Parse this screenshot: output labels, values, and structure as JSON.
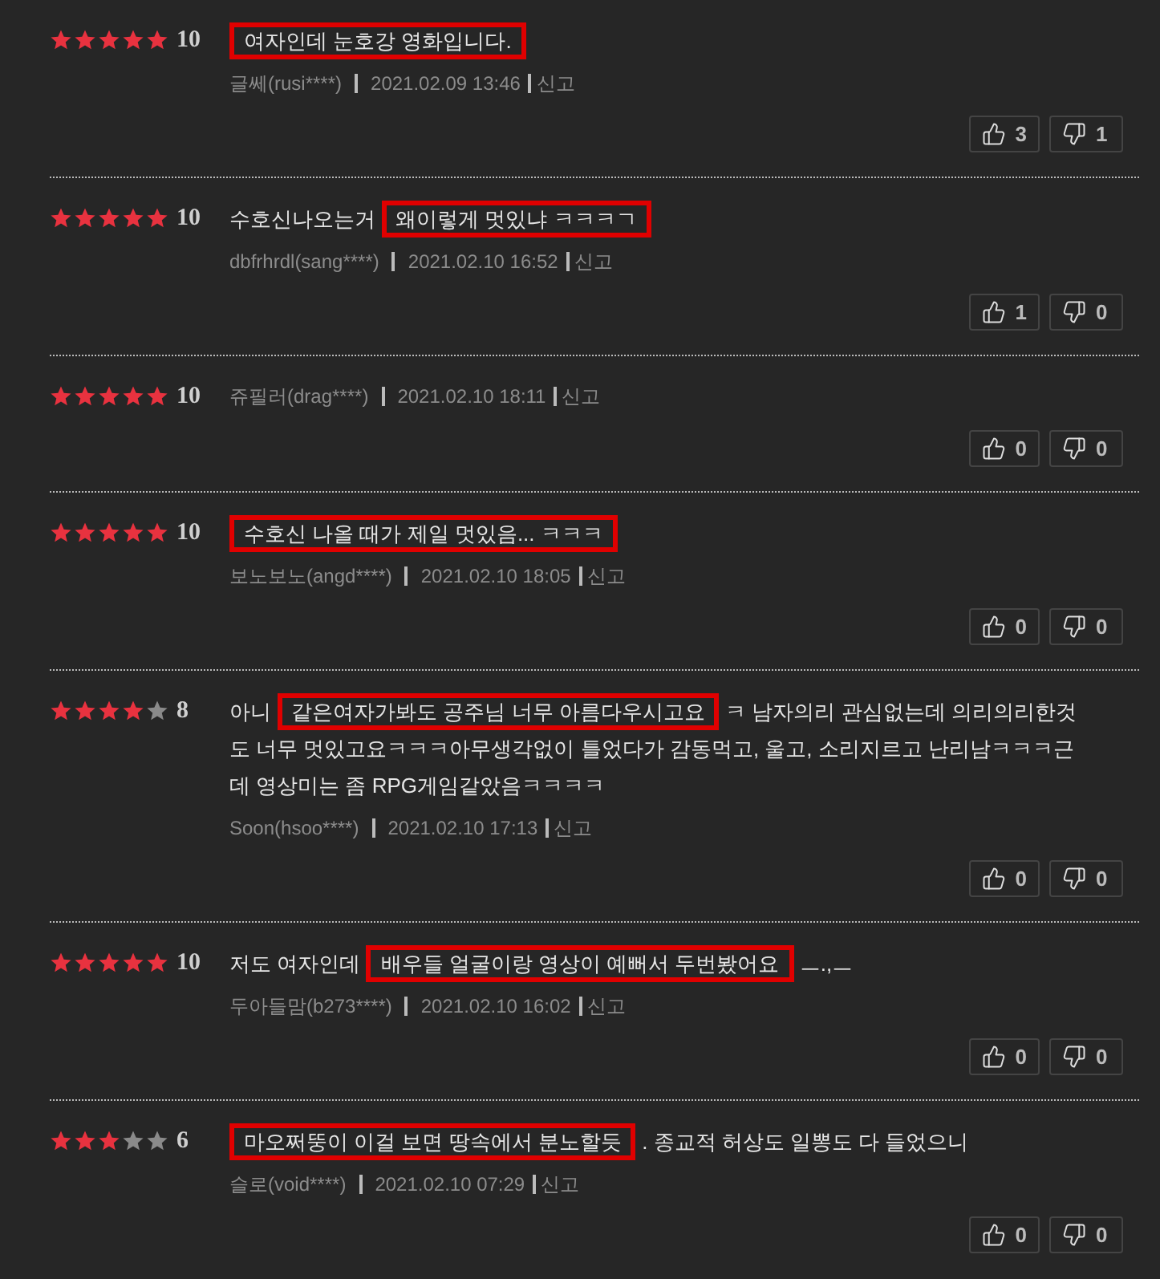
{
  "reviews": [
    {
      "stars": 5,
      "score": "10",
      "highlight": "여자인데 눈호강 영화입니다.",
      "user": "글쎄(rusi****)",
      "date": "2021.02.09 13:46",
      "report": "신고",
      "likes": "3",
      "dislikes": "1"
    },
    {
      "stars": 5,
      "score": "10",
      "text_before": "수호신나오는거",
      "highlight": "왜이렇게 멋있냐 ㅋㅋㅋㄱ",
      "user": "dbfrhrdl(sang****)",
      "date": "2021.02.10 16:52",
      "report": "신고",
      "likes": "1",
      "dislikes": "0"
    },
    {
      "stars": 5,
      "score": "10",
      "user": "쥬필러(drag****)",
      "date": "2021.02.10 18:11",
      "report": "신고",
      "likes": "0",
      "dislikes": "0"
    },
    {
      "stars": 5,
      "score": "10",
      "highlight": "수호신 나올 때가 제일 멋있음... ㅋㅋㅋ",
      "user": "보노보노(angd****)",
      "date": "2021.02.10 18:05",
      "report": "신고",
      "likes": "0",
      "dislikes": "0"
    },
    {
      "stars": 4,
      "score": "8",
      "text_before": "아니",
      "highlight": "같은여자가봐도 공주님 너무 아름다우시고요",
      "text_after": "ㅋ 남자의리 관심없는데 의리의리한것도 너무 멋있고요ㅋㅋㅋ아무생각없이 틀었다가 감동먹고, 울고, 소리지르고 난리남ㅋㅋㅋ근데 영상미는 좀 RPG게임같았음ㅋㅋㅋㅋ",
      "user": "Soon(hsoo****)",
      "date": "2021.02.10 17:13",
      "report": "신고",
      "likes": "0",
      "dislikes": "0"
    },
    {
      "stars": 5,
      "score": "10",
      "text_before": "저도 여자인데",
      "highlight": "배우들 얼굴이랑 영상이 예뻐서 두번봤어요",
      "text_after": "ㅡ.,ㅡ",
      "user": "두아들맘(b273****)",
      "date": "2021.02.10 16:02",
      "report": "신고",
      "likes": "0",
      "dislikes": "0"
    },
    {
      "stars": 3,
      "score": "6",
      "highlight": "마오쩌뚱이 이걸 보면 땅속에서 분노할듯",
      "text_after": ". 종교적 허상도 일뽕도 다 들었으니",
      "user": "슬로(void****)",
      "date": "2021.02.10 07:29",
      "report": "신고",
      "likes": "0",
      "dislikes": "0"
    }
  ]
}
